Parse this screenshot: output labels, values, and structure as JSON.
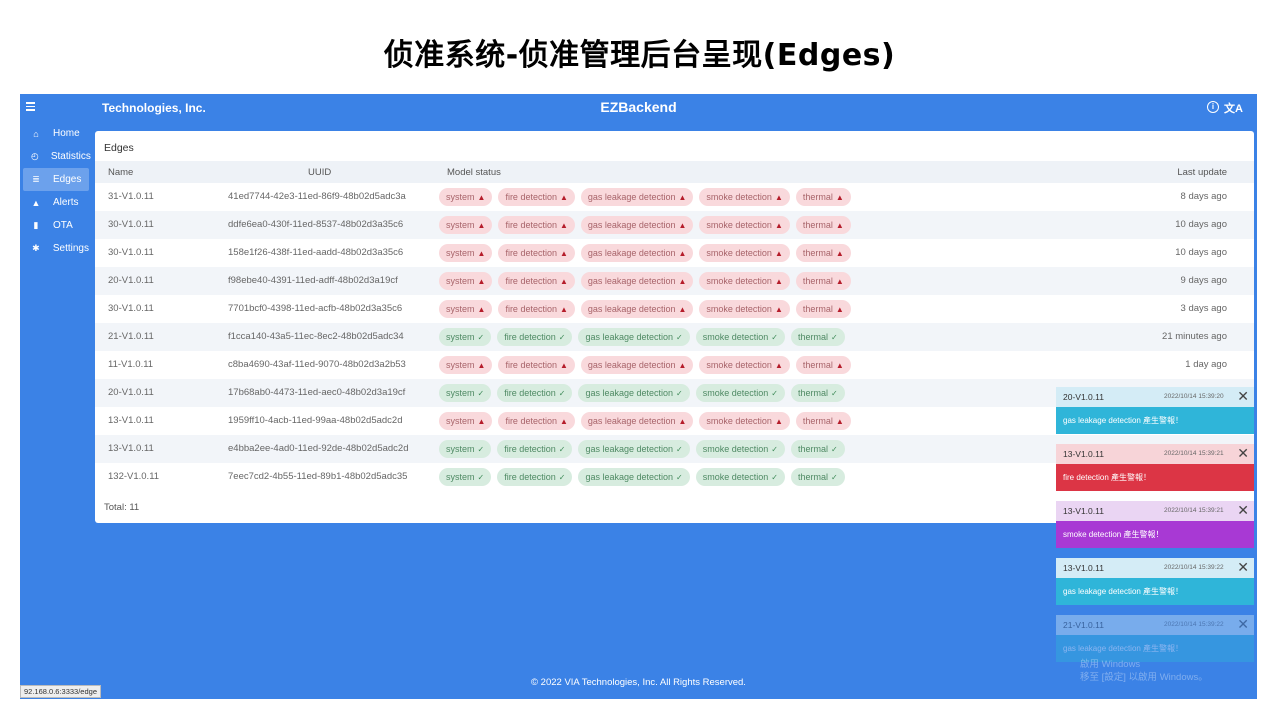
{
  "slide_title": "侦准系统-侦准管理后台呈现(Edges)",
  "app": {
    "brand": "Technologies, Inc.",
    "title": "EZBackend",
    "info_symbol": "i",
    "lang_symbol": "文A"
  },
  "sidebar": {
    "items": [
      {
        "label": "Home",
        "icon": "home-icon",
        "glyph": "⌂",
        "active": false
      },
      {
        "label": "Statistics",
        "icon": "gauge-icon",
        "glyph": "◴",
        "active": false
      },
      {
        "label": "Edges",
        "icon": "list-icon",
        "glyph": "≣",
        "active": true
      },
      {
        "label": "Alerts",
        "icon": "bell-icon",
        "glyph": "▲",
        "active": false
      },
      {
        "label": "OTA",
        "icon": "file-icon",
        "glyph": "▮",
        "active": false
      },
      {
        "label": "Settings",
        "icon": "gear-icon",
        "glyph": "✱",
        "active": false
      }
    ]
  },
  "panel": {
    "title": "Edges",
    "columns": {
      "name": "Name",
      "uuid": "UUID",
      "status": "Model status",
      "update": "Last update"
    },
    "status_labels": [
      "system",
      "fire detection",
      "gas leakage detection",
      "smoke detection",
      "thermal"
    ],
    "rows": [
      {
        "name": "31-V1.0.11",
        "uuid": "41ed7744-42e3-11ed-86f9-48b02d5adc3a",
        "statuses": [
          "bad",
          "bad",
          "bad",
          "bad",
          "bad"
        ],
        "update": "8 days ago"
      },
      {
        "name": "30-V1.0.11",
        "uuid": "ddfe6ea0-430f-11ed-8537-48b02d3a35c6",
        "statuses": [
          "bad",
          "bad",
          "bad",
          "bad",
          "bad"
        ],
        "update": "10 days ago"
      },
      {
        "name": "30-V1.0.11",
        "uuid": "158e1f26-438f-11ed-aadd-48b02d3a35c6",
        "statuses": [
          "bad",
          "bad",
          "bad",
          "bad",
          "bad"
        ],
        "update": "10 days ago"
      },
      {
        "name": "20-V1.0.11",
        "uuid": "f98ebe40-4391-11ed-adff-48b02d3a19cf",
        "statuses": [
          "bad",
          "bad",
          "bad",
          "bad",
          "bad"
        ],
        "update": "9 days ago"
      },
      {
        "name": "30-V1.0.11",
        "uuid": "7701bcf0-4398-11ed-acfb-48b02d3a35c6",
        "statuses": [
          "bad",
          "bad",
          "bad",
          "bad",
          "bad"
        ],
        "update": "3 days ago"
      },
      {
        "name": "21-V1.0.11",
        "uuid": "f1cca140-43a5-11ec-8ec2-48b02d5adc34",
        "statuses": [
          "ok",
          "ok",
          "ok",
          "ok",
          "ok"
        ],
        "update": "21 minutes ago"
      },
      {
        "name": "11-V1.0.11",
        "uuid": "c8ba4690-43af-11ed-9070-48b02d3a2b53",
        "statuses": [
          "bad",
          "bad",
          "bad",
          "bad",
          "bad"
        ],
        "update": "1 day ago"
      },
      {
        "name": "20-V1.0.11",
        "uuid": "17b68ab0-4473-11ed-aec0-48b02d3a19cf",
        "statuses": [
          "ok",
          "ok",
          "ok",
          "ok",
          "ok"
        ],
        "update": ""
      },
      {
        "name": "13-V1.0.11",
        "uuid": "1959ff10-4acb-11ed-99aa-48b02d5adc2d",
        "statuses": [
          "bad",
          "bad",
          "bad",
          "bad",
          "bad"
        ],
        "update": ""
      },
      {
        "name": "13-V1.0.11",
        "uuid": "e4bba2ee-4ad0-11ed-92de-48b02d5adc2d",
        "statuses": [
          "ok",
          "ok",
          "ok",
          "ok",
          "ok"
        ],
        "update": ""
      },
      {
        "name": "132-V1.0.11",
        "uuid": "7eec7cd2-4b55-11ed-89b1-48b02d5adc35",
        "statuses": [
          "ok",
          "ok",
          "ok",
          "ok",
          "ok"
        ],
        "update": ""
      }
    ],
    "total": "Total: 11"
  },
  "toasts": [
    {
      "name": "20-V1.0.11",
      "time": "2022/10/14 15:39:20",
      "message": "gas leakage detection 產生警報！",
      "head_bg": "#d4ecf6",
      "body_bg": "#2fb5d9",
      "faded": false
    },
    {
      "name": "13-V1.0.11",
      "time": "2022/10/14 15:39:21",
      "message": "fire detection 產生警報！",
      "head_bg": "#f7d4d8",
      "body_bg": "#dc3545",
      "faded": false
    },
    {
      "name": "13-V1.0.11",
      "time": "2022/10/14 15:39:21",
      "message": "smoke detection 產生警報！",
      "head_bg": "#ead5f3",
      "body_bg": "#a839d4",
      "faded": false
    },
    {
      "name": "13-V1.0.11",
      "time": "2022/10/14 15:39:22",
      "message": "gas leakage detection 產生警報！",
      "head_bg": "#d4ecf6",
      "body_bg": "#2fb5d9",
      "faded": false
    },
    {
      "name": "21-V1.0.11",
      "time": "2022/10/14 15:39:22",
      "message": "gas leakage detection 產生警報！",
      "head_bg": "#d4ecf6",
      "body_bg": "#2fb5d9",
      "faded": true
    }
  ],
  "watermark": {
    "line1": "啟用 Windows",
    "line2": "移至 [設定] 以啟用 Windows。"
  },
  "footer": "© 2022 VIA Technologies, Inc. All Rights Reserved.",
  "status_url": "92.168.0.6:3333/edge",
  "colors": {
    "app_bg": "#3b82e6",
    "bad_chip": "#f9d9dc",
    "ok_chip": "#d7ecdf",
    "bad_icon": "#b51d2b",
    "ok_icon": "#3e8a58"
  }
}
